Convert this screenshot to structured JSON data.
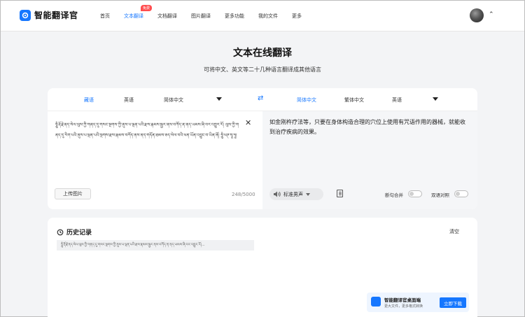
{
  "nav": {
    "brand": "智能翻译官",
    "items": [
      {
        "label": "首页",
        "active": false
      },
      {
        "label": "文本翻译",
        "active": true,
        "badge": "免费"
      },
      {
        "label": "文档翻译",
        "active": false
      },
      {
        "label": "图片翻译",
        "active": false
      },
      {
        "label": "更多功能",
        "active": false
      },
      {
        "label": "我的文件",
        "active": false
      },
      {
        "label": "更多",
        "active": false
      }
    ]
  },
  "header": {
    "title": "文本在线翻译",
    "subtitle": "可将中文、英文等二十几种语言翻译成其他语言"
  },
  "translator": {
    "source_langs": [
      "藏语",
      "英语",
      "简体中文"
    ],
    "target_langs": [
      "简体中文",
      "繁体中文",
      "英语"
    ],
    "source_text": "ཧཱུྃ་རྡོ་རྗེ་ནད་སེལ་ལུས་ཀྱི་གནད་དུ་གསང་སྔགས་ཀྱི་ནུས་པ་ལྡན་པའི་རྫས་རྣམས་སྦྱར་ནས་བཀོད་ན་ནད་ཡམས་ཞི་བར་འགྱུར་རོ། ལུས་ཀྱི་གནད་དུ་རིག་པའི་ནུས་པ་ལྡན་པའི་སྔགས་རྫས་རྣམས་བཀོད་ནས་ནད་གདོན་ཐམས་ཅད་སེལ་བའི་ཕན་ཡོན་འབྱུང་བ་ཡིན་ནོ། ཧཱུྃ་ཕཊ་སྭཱ་ཧཱ།",
    "char_count": "248/5000",
    "upload_label": "上传图片",
    "translated_text": "如金刚杵疗法等，只要在身体构造合理的穴位上使用有咒语作用的器械，就能收到治疗疾病的效果。",
    "voice_label": "标准男声",
    "toggle_sentence_merge": "断句合并",
    "toggle_bilingual": "双语对照"
  },
  "history": {
    "title": "历史记录",
    "clear_label": "清空",
    "items": [
      "ཧཱུྃ་རྡོ་རྗེ་ནད་སེལ་ལུས་ཀྱི་གནད་དུ་གསང་སྔགས་ཀྱི་ནུས་པ་ལྡན་པའི་རྫས་རྣམས་སྦྱར་ནས་བཀོད་ན་ནད་ཡམས་ཞི་བར་འགྱུར་རོ།..."
    ]
  },
  "promo": {
    "title": "智能翻译官桌面端",
    "subtitle": "更大文件，更多格式转换",
    "button": "立即下载"
  },
  "colors": {
    "accent": "#1677ff",
    "badge": "#ff4d4f"
  }
}
